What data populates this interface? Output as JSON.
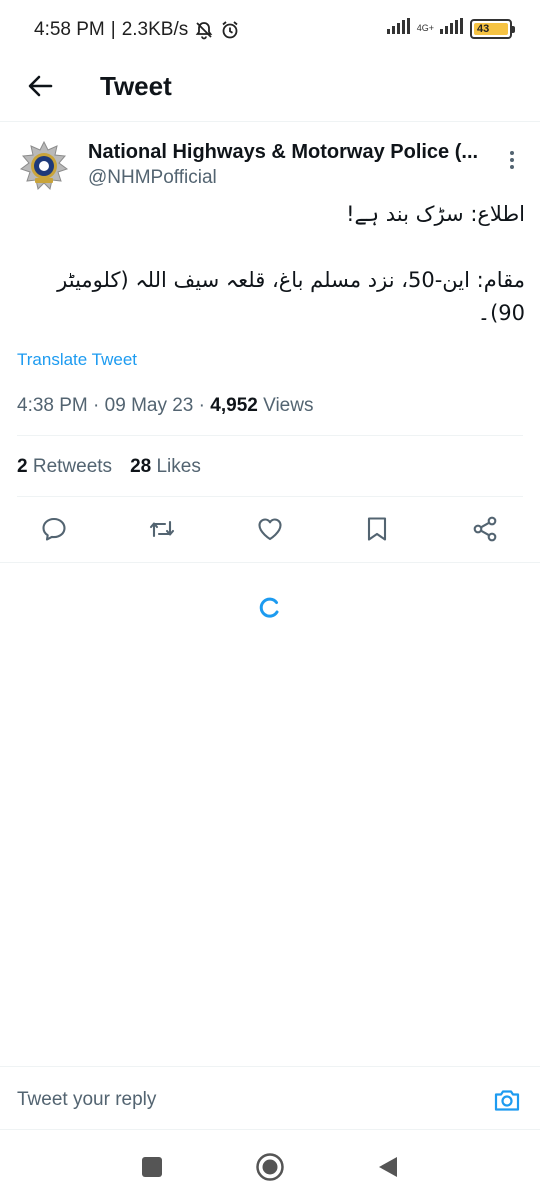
{
  "status_bar": {
    "time": "4:58 PM",
    "separator": "|",
    "speed": "2.3KB/s",
    "network_label": "4G+",
    "battery": "43",
    "icons": [
      "mute-bell-icon",
      "alarm-icon",
      "signal-icon",
      "battery-icon"
    ]
  },
  "header": {
    "title": "Tweet",
    "back_icon": "arrow-left-icon"
  },
  "tweet": {
    "author_name": "National Highways & Motorway Police (...",
    "author_handle": "@NHMPofficial",
    "text_lines": [
      "اطلاع: سڑک بند ہے!",
      "مقام: این-50، نزد مسلم باغ، قلعہ سیف اللہ (کلومیٹر 90)۔"
    ],
    "translate_label": "Translate Tweet",
    "time": "4:38 PM",
    "date": "09 May 23",
    "dot": "·",
    "views_count": "4,952",
    "views_label": "Views",
    "retweets_count": "2",
    "retweets_label": "Retweets",
    "likes_count": "28",
    "likes_label": "Likes"
  },
  "actions": [
    "reply-icon",
    "retweet-icon",
    "like-icon",
    "bookmark-icon",
    "share-icon"
  ],
  "reply": {
    "placeholder": "Tweet your reply"
  },
  "colors": {
    "accent": "#1d9bf0",
    "text": "#0f1419",
    "secondary": "#536471",
    "divider": "#eff3f4"
  }
}
